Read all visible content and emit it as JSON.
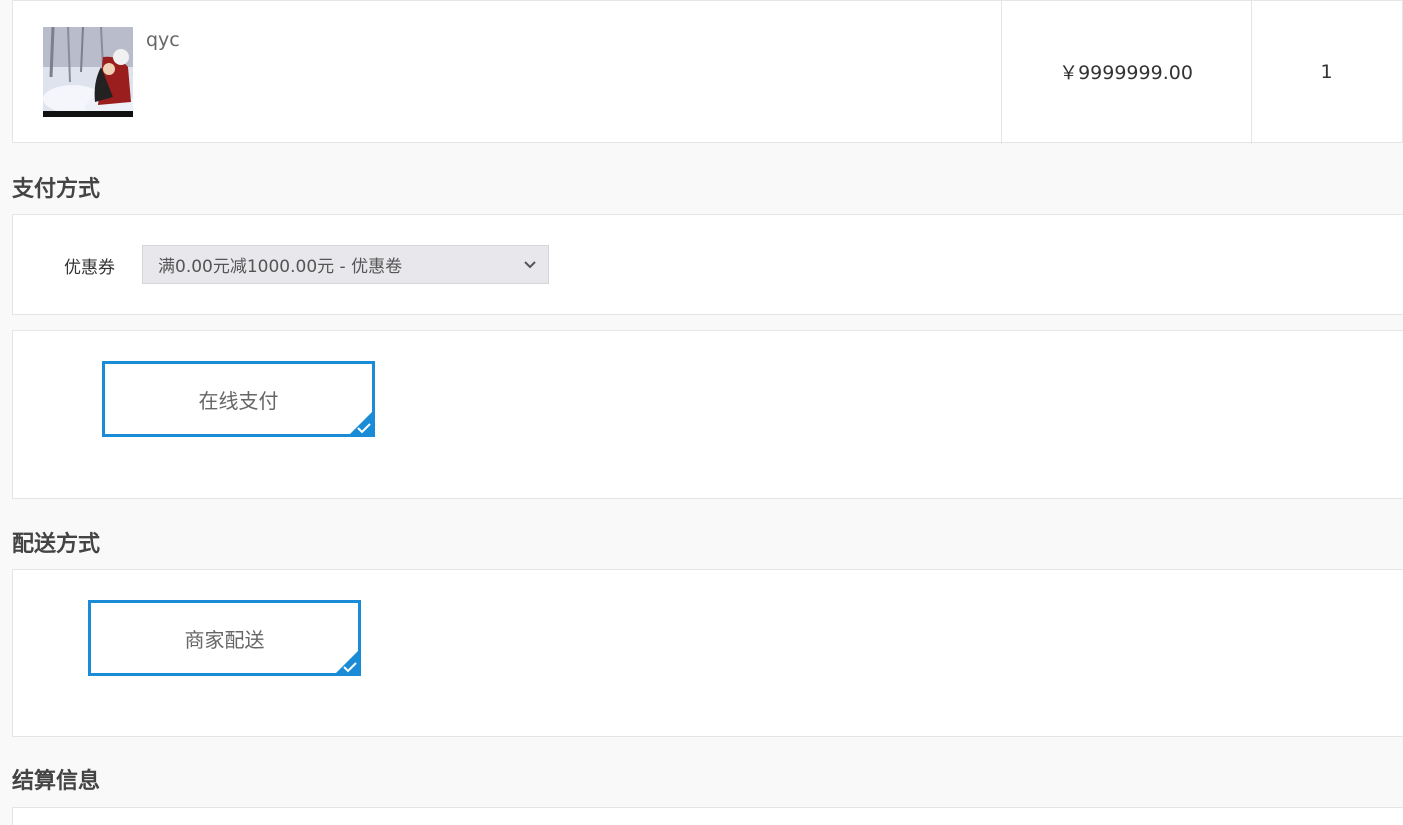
{
  "product": {
    "name": "qyc",
    "image_alt": "product thumbnail",
    "price": "￥9999999.00",
    "quantity": "1"
  },
  "payment_section": {
    "title": "支付方式",
    "coupon_label": "优惠券",
    "coupon_selected": "满0.00元减1000.00元 - 优惠卷",
    "option_label": "在线支付"
  },
  "delivery_section": {
    "title": "配送方式",
    "option_label": "商家配送"
  },
  "checkout_section": {
    "title": "结算信息"
  },
  "colors": {
    "accent": "#1a8bd6",
    "border": "#e5e5e5",
    "background": "#f9f9f9"
  }
}
